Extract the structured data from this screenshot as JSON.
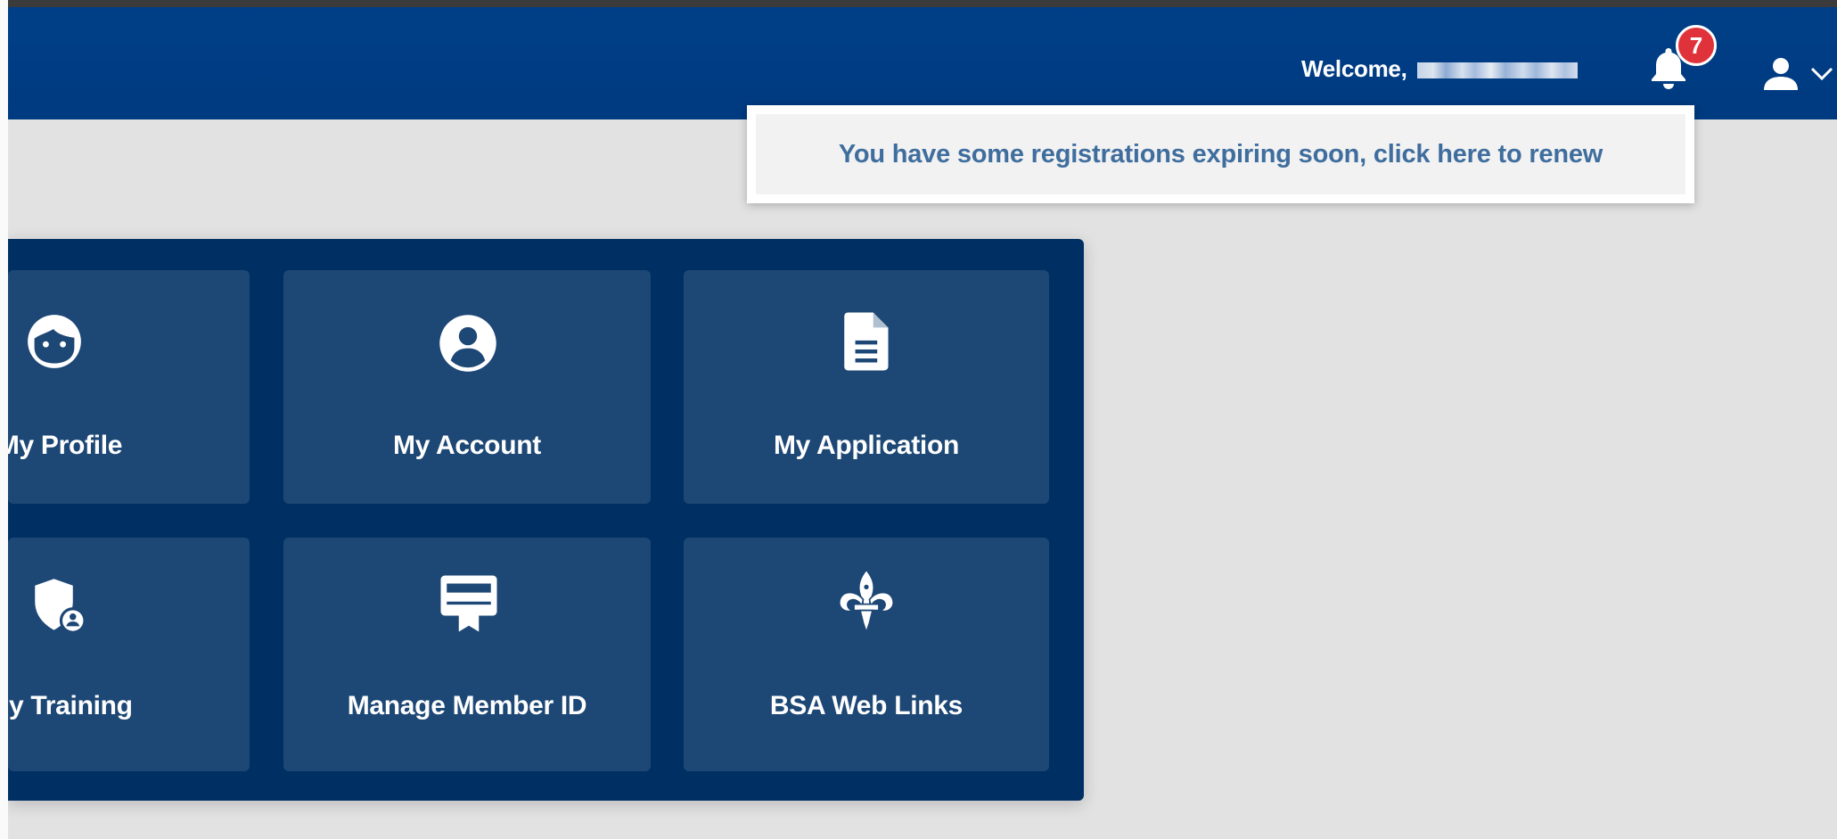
{
  "header": {
    "welcome_text": "Welcome,",
    "notification_count": "7",
    "user_menu_chevron": "chevron-down-icon"
  },
  "notification": {
    "message": "You have some registrations expiring soon, click here to renew"
  },
  "tiles": [
    {
      "label": "My Profile",
      "icon": "face-icon"
    },
    {
      "label": "My Account",
      "icon": "account-circle-icon"
    },
    {
      "label": "My Application",
      "icon": "document-icon"
    },
    {
      "label": "My Training",
      "icon": "shield-user-icon"
    },
    {
      "label": "Manage Member ID",
      "icon": "member-card-icon"
    },
    {
      "label": "BSA Web Links",
      "icon": "fleur-de-lis-icon"
    }
  ],
  "colors": {
    "header_bg": "#003f87",
    "panel_bg": "#003063",
    "tile_bg": "#1d4775",
    "badge_bg": "#e0323a",
    "notification_text": "#3f6e9e",
    "page_bg": "#e2e2e2"
  }
}
